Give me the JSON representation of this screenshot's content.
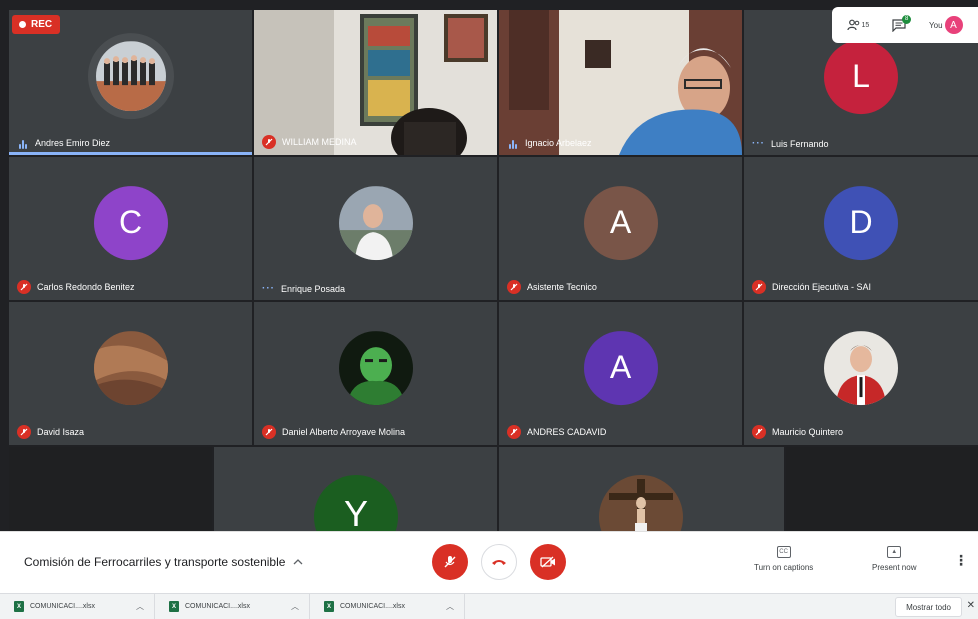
{
  "recording": {
    "label": "REC"
  },
  "top_right": {
    "participants_count": "15",
    "chat_count": "8",
    "you_label": "You",
    "you_initial": "A"
  },
  "participants": [
    {
      "name": "Andres Emiro Diez",
      "status": "speaking"
    },
    {
      "name": "WILLIAM MEDINA",
      "status": "muted"
    },
    {
      "name": "Ignacio Arbelaez",
      "status": "speaking"
    },
    {
      "name": "Luis Fernando",
      "status": "more",
      "initial": "L",
      "color": "#c5223d"
    },
    {
      "name": "Carlos Redondo Benitez",
      "status": "muted",
      "initial": "C",
      "color": "#8e44c9"
    },
    {
      "name": "Enrique Posada",
      "status": "more"
    },
    {
      "name": "Asistente Tecnico",
      "status": "muted",
      "initial": "A",
      "color": "#795548"
    },
    {
      "name": "Dirección Ejecutiva - SAI",
      "status": "muted",
      "initial": "D",
      "color": "#3f51b5"
    },
    {
      "name": "David Isaza",
      "status": "muted"
    },
    {
      "name": "Daniel Alberto Arroyave Molina",
      "status": "muted"
    },
    {
      "name": "ANDRES CADAVID",
      "status": "muted",
      "initial": "A",
      "color": "#5e35b1"
    },
    {
      "name": "Mauricio Quintero",
      "status": "muted"
    },
    {
      "initial": "Y",
      "color": "#1b5e20"
    }
  ],
  "controls": {
    "meeting_title": "Comisión de Ferrocarriles y transporte sostenible",
    "captions_label": "Turn on captions",
    "captions_icon_text": "CC",
    "present_label": "Present now"
  },
  "downloads": {
    "items": [
      {
        "file": "COMUNICACI....xlsx"
      },
      {
        "file": "COMUNICACI....xlsx"
      },
      {
        "file": "COMUNICACI....xlsx"
      }
    ],
    "show_all_label": "Mostrar todo"
  }
}
